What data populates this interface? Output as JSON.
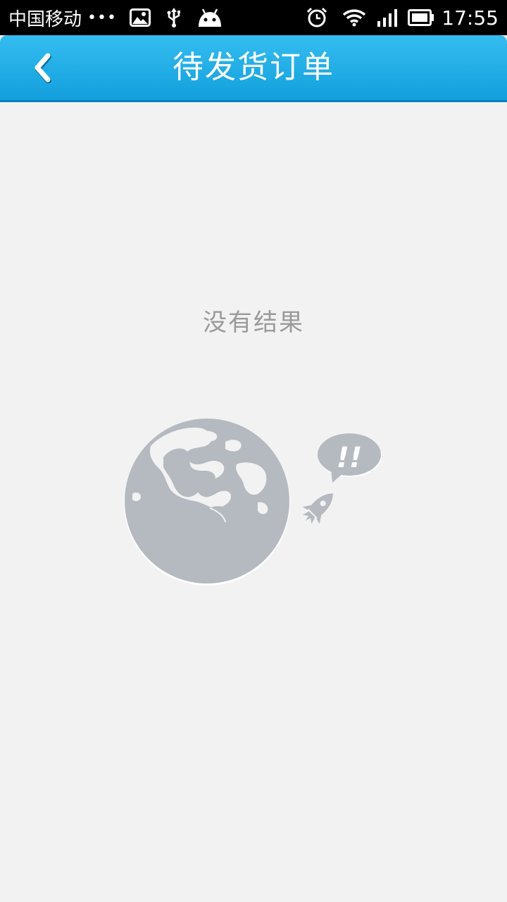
{
  "status_bar": {
    "carrier": "中国移动",
    "dots": "•••",
    "time": "17:55",
    "icons": [
      "gallery-icon",
      "usb-icon",
      "android-icon",
      "alarm-icon",
      "wifi-icon",
      "signal-icon",
      "battery-icon"
    ]
  },
  "header": {
    "title": "待发货订单",
    "back_icon": "chevron-left-icon"
  },
  "empty_state": {
    "message": "没有结果",
    "illustration": "globe-rocket-illustration",
    "bubble_text": "!!"
  },
  "colors": {
    "title_bar": "#21aee6",
    "background": "#f2f2f2",
    "illustration": "#b5b9c0",
    "empty_text": "#9a9a9a"
  }
}
